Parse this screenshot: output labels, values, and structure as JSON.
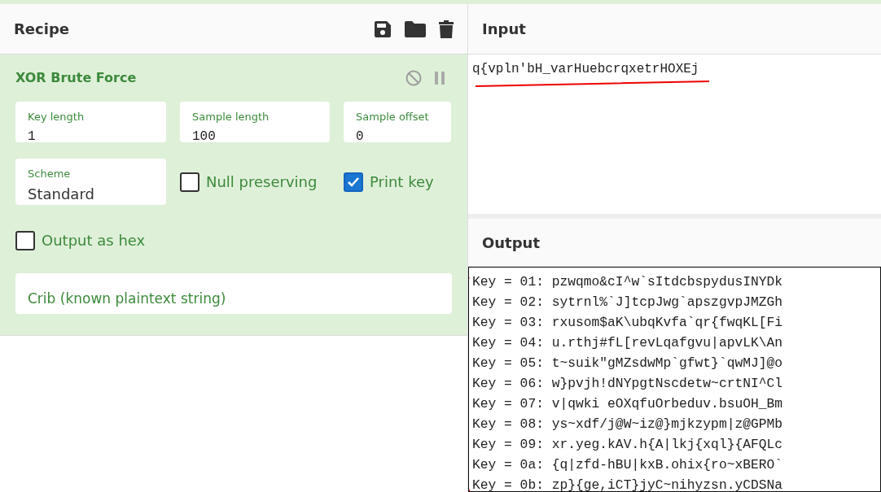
{
  "recipe": {
    "title": "Recipe",
    "operation": {
      "title": "XOR Brute Force",
      "disabled": false,
      "paused": false,
      "fields": [
        {
          "kind": "text",
          "label": "Key length",
          "value": "1"
        },
        {
          "kind": "text",
          "label": "Sample length",
          "value": "100"
        },
        {
          "kind": "text",
          "label": "Sample offset",
          "value": "0"
        },
        {
          "kind": "select",
          "label": "Scheme",
          "value": "Standard"
        },
        {
          "kind": "checkbox",
          "label": "Null preserving",
          "checked": false
        },
        {
          "kind": "checkbox",
          "label": "Print key",
          "checked": true
        },
        {
          "kind": "checkbox",
          "label": "Output as hex",
          "checked": false
        },
        {
          "kind": "input",
          "placeholder": "Crib (known plaintext string)"
        }
      ]
    }
  },
  "input": {
    "title": "Input",
    "text": "q{vpln'bH_varHuebcrqxetrHOXEj"
  },
  "output": {
    "title": "Output",
    "lines": [
      "Key = 01: pzwqmo&cI^w`sItdcbspydusINYDk",
      "Key = 02: sytrnl%`J]tcpJwg`apszgvpJMZGh",
      "Key = 03: rxusom$aK\\ubqKvfa`qr{fwqKL[Fi",
      "Key = 04: u.rthj#fL[revLqafgvu|apvLK\\An",
      "Key = 05: t~suik\"gMZsdwMp`gfwt}`qwMJ]@o",
      "Key = 06: w}pvjh!dNYpgtNscdetw~crtNI^Cl",
      "Key = 07: v|qwki eOXqfuOrbeduv.bsuOH_Bm",
      "Key = 08: ys~xdf/j@W~iz@}mjkzypm|z@GPMb",
      "Key = 09: xr.yeg.kAV.h{A|lkj{xql}{AFQLc",
      "Key = 0a: {q|zfd-hBU|kxB.ohix{ro~xBERO`",
      "Key = 0b: zp}{ge,iCT}jyC~nihyzsn.yCDSNa"
    ]
  }
}
